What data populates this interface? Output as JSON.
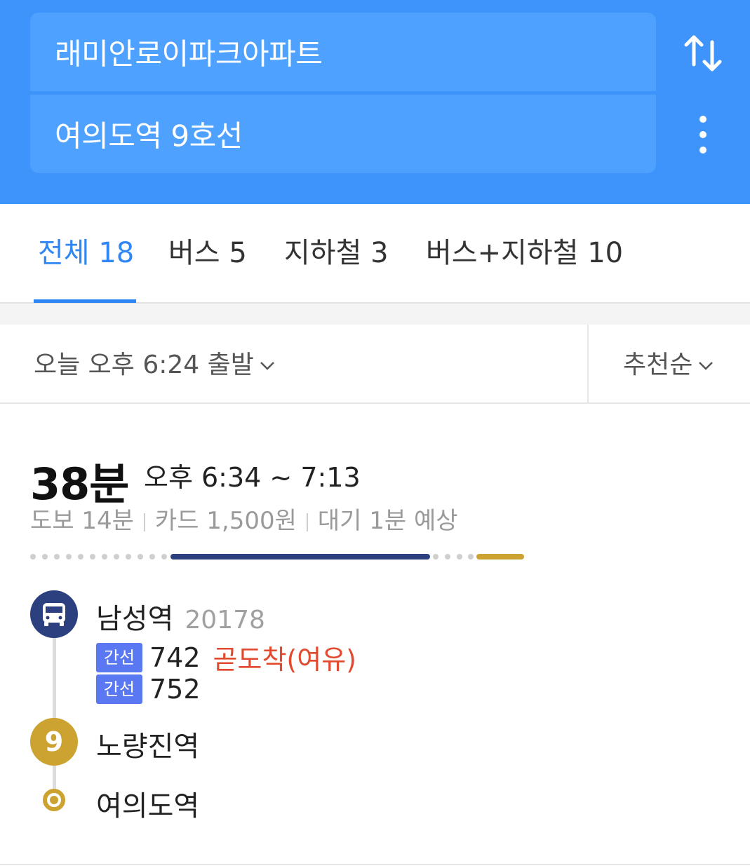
{
  "search": {
    "origin": "래미안로이파크아파트",
    "destination": "여의도역 9호선"
  },
  "tabs": [
    {
      "label": "전체 18",
      "active": true
    },
    {
      "label": "버스 5",
      "active": false
    },
    {
      "label": "지하철 3",
      "active": false
    },
    {
      "label": "버스+지하철 10",
      "active": false
    }
  ],
  "filter": {
    "departure": "오늘 오후 6:24 출발",
    "sort": "추천순"
  },
  "route": {
    "duration": "38분",
    "time_range": "오후 6:34 ~ 7:13",
    "walk": "도보 14분",
    "fare": "카드 1,500원",
    "wait": "대기 1분 예상",
    "stops": [
      {
        "name": "남성역",
        "stop_id": "20178",
        "icon": "bus-icon",
        "buses": [
          {
            "type": "간선",
            "number": "742",
            "status": "곧도착(여유)"
          },
          {
            "type": "간선",
            "number": "752",
            "status": ""
          }
        ]
      },
      {
        "name": "노량진역",
        "line": "9",
        "icon": "subway-line-9-icon"
      },
      {
        "name": "여의도역",
        "icon": "destination-dot-icon"
      }
    ]
  },
  "colors": {
    "header_bg": "#3f94fb",
    "field_bg": "#4ea1ff",
    "tab_active": "#2f86f5",
    "bus_segment": "#2c3f7e",
    "subway_line9": "#cca230",
    "bus_type_badge": "#5a78f2",
    "arrival_status": "#e24a2f"
  }
}
